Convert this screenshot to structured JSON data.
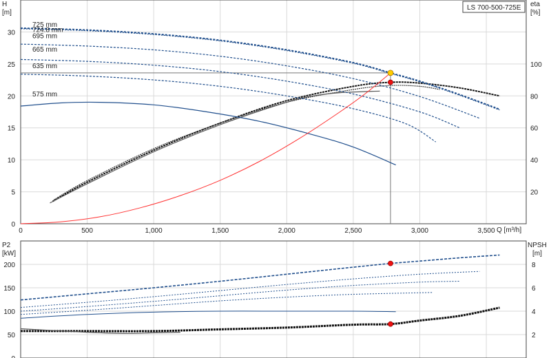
{
  "chart_data": [
    {
      "type": "line",
      "model_label": "LS 700-500-725E",
      "xlabel": "Q [m³/h]",
      "ylabel_left": [
        "H",
        "[m]"
      ],
      "ylabel_right": [
        "eta",
        "[%]"
      ],
      "xlim": [
        0,
        3800
      ],
      "ylim_left": [
        0,
        35
      ],
      "ylim_right": [
        0,
        140
      ],
      "xticks": [
        0,
        500,
        1000,
        1500,
        2000,
        2500,
        3000,
        3500
      ],
      "xtick_labels": [
        "0",
        "500",
        "1,000",
        "1,500",
        "2,000",
        "2,500",
        "3,000",
        "3,500"
      ],
      "yticks_left": [
        0,
        5,
        10,
        15,
        20,
        25,
        30
      ],
      "yticks_right": [
        20,
        40,
        60,
        80,
        100
      ],
      "grid": true,
      "head_curves": [
        {
          "name": "725 mm",
          "label_y": 30.6,
          "color": "#1f4e8c",
          "dash": "3,2",
          "points": [
            [
              0,
              30.6
            ],
            [
              500,
              30.3
            ],
            [
              1000,
              29.7
            ],
            [
              1500,
              28.7
            ],
            [
              2000,
              27.2
            ],
            [
              2500,
              25.2
            ],
            [
              2780,
              23.6
            ],
            [
              3000,
              22.3
            ],
            [
              3300,
              20.2
            ],
            [
              3600,
              17.9
            ]
          ]
        },
        {
          "name": "724.8 mm",
          "label_y": 29.8,
          "color": "#1f4e8c",
          "dash": "2,2",
          "points": [
            [
              0,
              30.5
            ],
            [
              500,
              30.2
            ],
            [
              1000,
              29.6
            ],
            [
              1500,
              28.6
            ],
            [
              2000,
              27.1
            ],
            [
              2500,
              25.1
            ],
            [
              2780,
              23.5
            ],
            [
              3000,
              22.2
            ],
            [
              3300,
              20.1
            ],
            [
              3600,
              17.8
            ]
          ]
        },
        {
          "name": "695 mm",
          "label_y": 28.8,
          "color": "#1f4e8c",
          "dash": "3,2",
          "points": [
            [
              0,
              28.1
            ],
            [
              500,
              27.8
            ],
            [
              1000,
              27.2
            ],
            [
              1500,
              26.2
            ],
            [
              2000,
              24.7
            ],
            [
              2500,
              22.7
            ],
            [
              3000,
              19.9
            ],
            [
              3450,
              16.5
            ]
          ]
        },
        {
          "name": "665 mm",
          "label_y": 26.7,
          "color": "#1f4e8c",
          "dash": "3,2",
          "points": [
            [
              0,
              25.7
            ],
            [
              500,
              25.4
            ],
            [
              1000,
              24.8
            ],
            [
              1500,
              23.8
            ],
            [
              2000,
              22.3
            ],
            [
              2500,
              20.3
            ],
            [
              3000,
              17.5
            ],
            [
              3300,
              15.0
            ]
          ]
        },
        {
          "name": "635 mm",
          "label_y": 24.1,
          "color": "#1f4e8c",
          "dash": "3,2",
          "points": [
            [
              0,
              23.4
            ],
            [
              500,
              23.1
            ],
            [
              1000,
              22.5
            ],
            [
              1500,
              21.5
            ],
            [
              2000,
              20.0
            ],
            [
              2500,
              18.0
            ],
            [
              2900,
              15.6
            ],
            [
              3120,
              12.8
            ]
          ]
        },
        {
          "name": "575 mm",
          "label_y": 19.7,
          "color": "#1f4e8c",
          "dash": "",
          "points": [
            [
              0,
              18.4
            ],
            [
              300,
              18.9
            ],
            [
              600,
              19.0
            ],
            [
              1000,
              18.6
            ],
            [
              1400,
              17.5
            ],
            [
              1800,
              16.0
            ],
            [
              2200,
              13.9
            ],
            [
              2500,
              12.0
            ],
            [
              2820,
              9.2
            ]
          ]
        }
      ],
      "efficiency_curves": [
        {
          "name": "",
          "color": "#111111",
          "dash": "3,1",
          "points": [
            [
              240,
              14
            ],
            [
              500,
              26
            ],
            [
              1000,
              46
            ],
            [
              1500,
              63
            ],
            [
              2000,
              77
            ],
            [
              2500,
              86
            ],
            [
              2780,
              88.5
            ],
            [
              3000,
              88
            ],
            [
              3300,
              85
            ],
            [
              3600,
              80
            ]
          ]
        },
        {
          "name": "",
          "color": "#333333",
          "dash": "2,1",
          "points": [
            [
              250,
              15
            ],
            [
              500,
              27
            ],
            [
              1000,
              47
            ],
            [
              1500,
              63
            ],
            [
              2000,
              76
            ],
            [
              2500,
              84
            ],
            [
              2780,
              86.5
            ],
            [
              3000,
              86
            ],
            [
              3150,
              84
            ]
          ]
        },
        {
          "name": "",
          "color": "#555555",
          "dash": "",
          "points": [
            [
              220,
              13
            ],
            [
              500,
              25
            ],
            [
              1000,
              45
            ],
            [
              1500,
              62
            ],
            [
              2000,
              76
            ],
            [
              2200,
              80
            ],
            [
              2400,
              82
            ],
            [
              2700,
              83
            ]
          ]
        }
      ],
      "system_curve": {
        "color": "#ff3030",
        "points": [
          [
            0,
            0
          ],
          [
            300,
            0.3
          ],
          [
            600,
            1.1
          ],
          [
            900,
            2.5
          ],
          [
            1200,
            4.4
          ],
          [
            1500,
            6.8
          ],
          [
            1800,
            9.8
          ],
          [
            2100,
            13.4
          ],
          [
            2400,
            17.5
          ],
          [
            2600,
            20.5
          ],
          [
            2780,
            23.6
          ]
        ]
      },
      "duty_point": {
        "q": 2780,
        "h": 23.6,
        "eta": 88.5
      },
      "reference_line_h": 23.6
    },
    {
      "type": "line",
      "ylabel_left": [
        "P2",
        "[kW]"
      ],
      "ylabel_right": [
        "NPSH",
        "[m]"
      ],
      "xlim": [
        0,
        3800
      ],
      "ylim_left": [
        0,
        250
      ],
      "ylim_right": [
        0,
        10
      ],
      "yticks_left": [
        0,
        50,
        100,
        150,
        200
      ],
      "yticks_right": [
        2,
        4,
        6,
        8
      ],
      "grid": true,
      "power_curves": [
        {
          "name": "725 mm",
          "color": "#1f4e8c",
          "dash": "4,2",
          "points": [
            [
              0,
              124
            ],
            [
              500,
              137
            ],
            [
              1000,
              150
            ],
            [
              1500,
              164
            ],
            [
              2000,
              179
            ],
            [
              2500,
              194
            ],
            [
              2780,
              202
            ],
            [
              3000,
              207
            ],
            [
              3300,
              214
            ],
            [
              3600,
              220
            ]
          ]
        },
        {
          "name": "695 mm",
          "color": "#1f4e8c",
          "dash": "2,2",
          "points": [
            [
              0,
              108
            ],
            [
              500,
              119
            ],
            [
              1000,
              131
            ],
            [
              1500,
              144
            ],
            [
              2000,
              157
            ],
            [
              2500,
              169
            ],
            [
              3000,
              179
            ],
            [
              3450,
              185
            ]
          ]
        },
        {
          "name": "665 mm",
          "color": "#1f4e8c",
          "dash": "2,2",
          "points": [
            [
              0,
              100
            ],
            [
              500,
              110
            ],
            [
              1000,
              121
            ],
            [
              1500,
              133
            ],
            [
              2000,
              145
            ],
            [
              2500,
              155
            ],
            [
              3000,
              162
            ],
            [
              3300,
              164
            ]
          ]
        },
        {
          "name": "635 mm",
          "color": "#1f4e8c",
          "dash": "2,2",
          "points": [
            [
              0,
              93
            ],
            [
              500,
              102
            ],
            [
              1000,
              112
            ],
            [
              1500,
              122
            ],
            [
              2000,
              130
            ],
            [
              2500,
              136
            ],
            [
              3100,
              140
            ]
          ]
        },
        {
          "name": "575 mm",
          "color": "#1f4e8c",
          "dash": "",
          "points": [
            [
              0,
              85
            ],
            [
              500,
              93
            ],
            [
              1000,
              98
            ],
            [
              1500,
              100
            ],
            [
              2000,
              100
            ],
            [
              2500,
              100
            ],
            [
              2820,
              99
            ]
          ]
        }
      ],
      "npsh_curves": [
        {
          "name": "",
          "color": "#111111",
          "dash": "3,1",
          "points": [
            [
              0,
              2.3
            ],
            [
              500,
              2.3
            ],
            [
              1000,
              2.3
            ],
            [
              1500,
              2.45
            ],
            [
              2000,
              2.6
            ],
            [
              2500,
              2.85
            ],
            [
              2780,
              2.9
            ],
            [
              3000,
              3.2
            ],
            [
              3300,
              3.6
            ],
            [
              3600,
              4.3
            ]
          ]
        },
        {
          "name": "",
          "color": "#555555",
          "dash": "",
          "points": [
            [
              0,
              2.5
            ],
            [
              500,
              2.2
            ],
            [
              800,
              2.1
            ],
            [
              1000,
              2.15
            ],
            [
              1200,
              2.2
            ]
          ]
        }
      ],
      "duty_points": [
        {
          "q": 2780,
          "p2": 202
        },
        {
          "q": 2780,
          "npsh": 2.9
        }
      ]
    }
  ]
}
